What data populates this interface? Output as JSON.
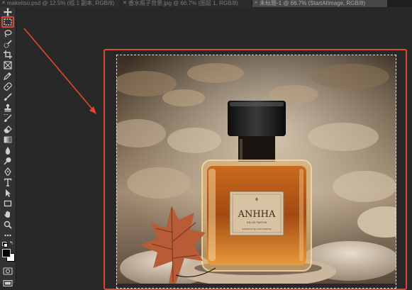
{
  "tabs": [
    {
      "label": "makeitso.psd @ 12.5% (组 1 副本, RGB/8)",
      "active": false
    },
    {
      "label": "香水瓶子背景.jpg @ 66.7% (图层 1, RGB/8)",
      "active": false
    },
    {
      "label": "未标题-1 @ 66.7% (StartAIImage, RGB/8)",
      "active": true
    }
  ],
  "toolbar": {
    "tools": [
      "move-icon",
      "rectangular-marquee-icon",
      "lasso-icon",
      "quick-selection-icon",
      "crop-icon",
      "frame-icon",
      "eyedropper-icon",
      "healing-brush-icon",
      "brush-icon",
      "clone-stamp-icon",
      "history-brush-icon",
      "eraser-icon",
      "gradient-icon",
      "blur-icon",
      "dodge-icon",
      "pen-icon",
      "type-icon",
      "path-selection-icon",
      "rectangle-shape-icon",
      "hand-icon",
      "zoom-icon",
      "more-tools-icon"
    ],
    "selected_tool": "rectangular-marquee-icon",
    "foreground_color": "#000000",
    "background_color": "#ffffff"
  },
  "document": {
    "bottle_label_title": "ANHHA",
    "bottle_label_subtitle": "EAU DE PARFUM",
    "bottle_label_small": "ESSENCE DE LUXE PARFUM"
  },
  "annotation": {
    "highlight_color": "#e0482d"
  }
}
